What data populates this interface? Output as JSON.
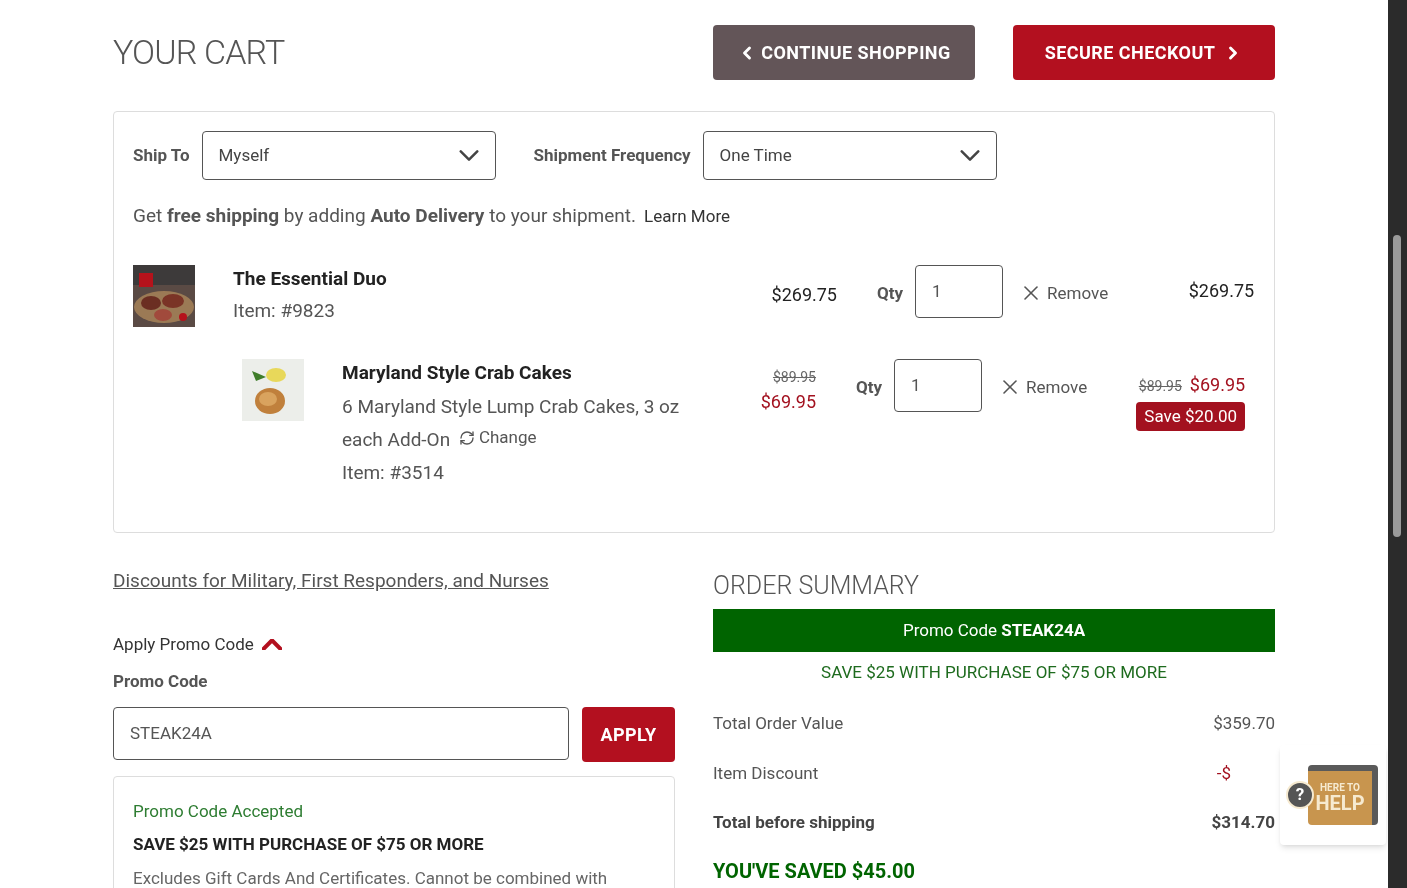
{
  "header": {
    "title": "YOUR CART",
    "continue_button": "CONTINUE SHOPPING",
    "checkout_button": "SECURE CHECKOUT"
  },
  "cart": {
    "ship_to": {
      "label": "Ship To",
      "value": "Myself"
    },
    "frequency": {
      "label": "Shipment Frequency",
      "value": "One Time"
    },
    "promo_line": {
      "text": "Get **free shipping** by adding **Auto Delivery** to your shipment.",
      "link": "Learn More"
    },
    "items": [
      {
        "kind": "main",
        "name": "The Essential Duo",
        "item_no": "Item: #9823",
        "price": "$269.75",
        "qty_label": "Qty",
        "qty": "1",
        "remove": "Remove",
        "total": "$269.75"
      },
      {
        "kind": "addon",
        "name": "Maryland Style Crab Cakes",
        "description": "6 Maryland Style Lump Crab Cakes, 3 oz each Add-On",
        "change": "Change",
        "item_no": "Item: #3514",
        "old_price": "$89.95",
        "price": "$69.95",
        "qty_label": "Qty",
        "qty": "1",
        "remove": "Remove",
        "old_total": "$89.95",
        "total": "$69.95",
        "save_badge": "Save $20.00"
      }
    ]
  },
  "discount_link": "Discounts for Military, First Responders, and Nurses",
  "promo": {
    "toggle": "Apply Promo Code",
    "expanded": true,
    "label": "Promo Code",
    "value": "STEAK24A",
    "apply_button": "APPLY",
    "accepted": {
      "status": "Promo Code Accepted",
      "title": "SAVE $25 WITH PURCHASE OF $75 OR MORE",
      "text": "Excludes Gift Cards And Certificates. Cannot be combined with"
    }
  },
  "order_summary": {
    "title": "ORDER SUMMARY",
    "banner": "Promo Code **STEAK24A**",
    "banner_note": "SAVE $25 WITH PURCHASE OF $75 OR MORE",
    "rows": [
      {
        "kind": "normal",
        "label": "Total Order Value",
        "value": "$359.70"
      },
      {
        "kind": "discount",
        "label": "Item Discount",
        "value": "-$"
      },
      {
        "kind": "total",
        "label": "Total before shipping",
        "value": "$314.70"
      }
    ],
    "saved": "YOU'VE SAVED $45.00"
  },
  "help_widget": {
    "line1": "HERE TO",
    "line2": "HELP",
    "badge": "?"
  }
}
